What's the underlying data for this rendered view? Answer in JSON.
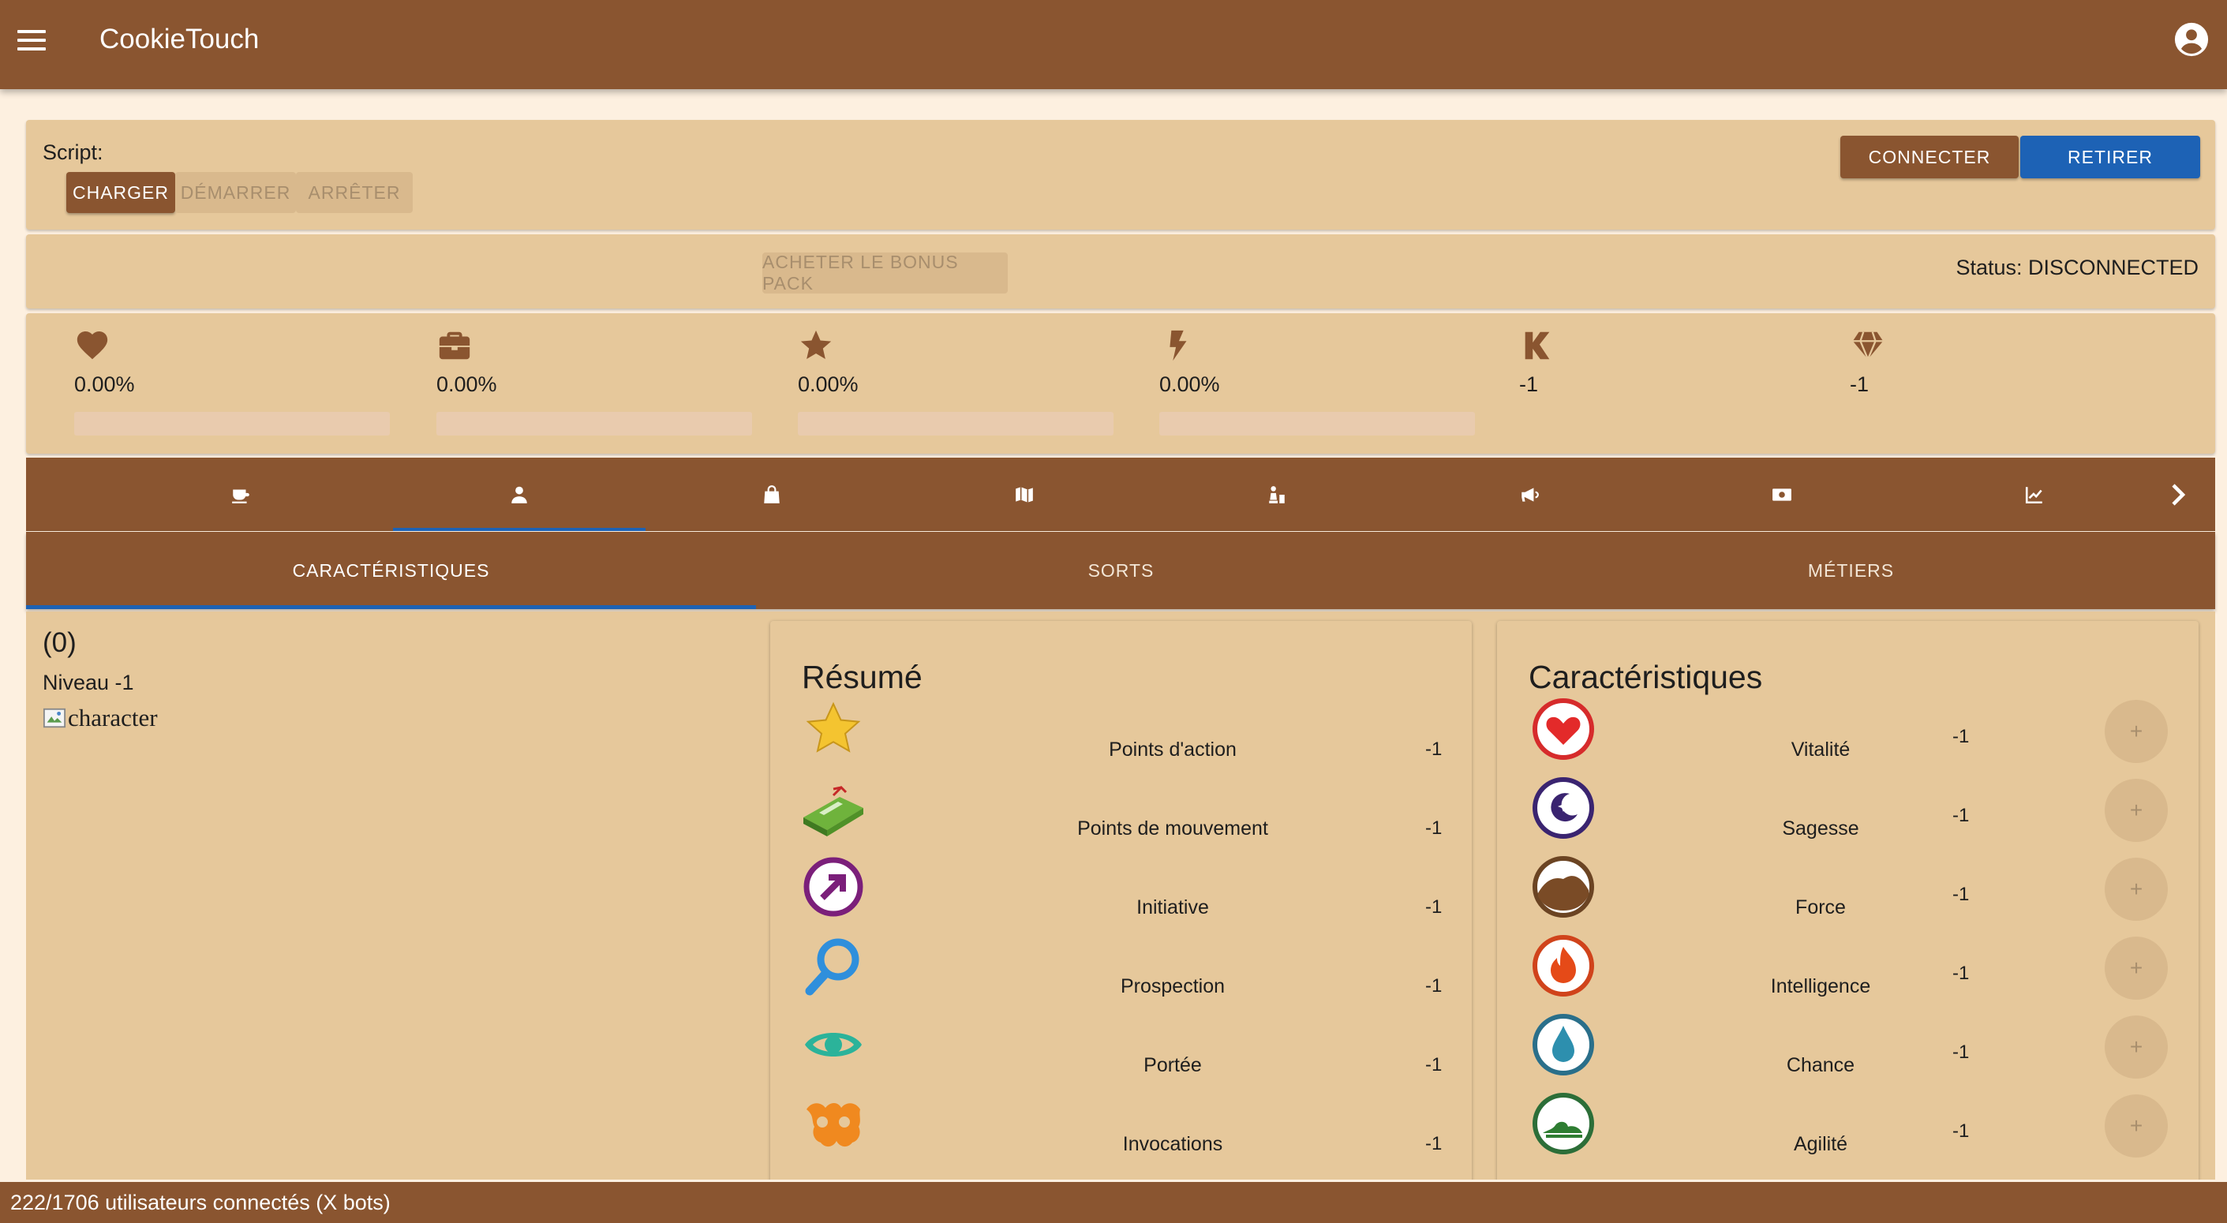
{
  "app": {
    "title": "CookieTouch"
  },
  "script": {
    "label": "Script:",
    "load": "CHARGER",
    "start": "DÉMARRER",
    "stop": "ARRÊTER",
    "connect": "CONNECTER",
    "remove": "RETIRER"
  },
  "bonus": {
    "buy": "ACHETER LE BONUS PACK",
    "status": "Status: DISCONNECTED"
  },
  "stats": [
    {
      "icon": "heart-icon",
      "value": "0.00%",
      "progress": 0
    },
    {
      "icon": "briefcase-icon",
      "value": "0.00%",
      "progress": 0
    },
    {
      "icon": "star-icon",
      "value": "0.00%",
      "progress": 0
    },
    {
      "icon": "bolt-icon",
      "value": "0.00%",
      "progress": 0
    },
    {
      "icon": "kamas-icon",
      "value": "-1"
    },
    {
      "icon": "gem-icon",
      "value": "-1"
    }
  ],
  "nav": {
    "tabs": [
      "coffee-icon",
      "person-icon",
      "bag-icon",
      "map-icon",
      "chess-icon",
      "megaphone-icon",
      "money-icon",
      "chart-icon"
    ],
    "active": "person-icon",
    "next": "chevron-right-icon"
  },
  "subtabs": {
    "items": [
      "CARACTÉRISTIQUES",
      "SORTS",
      "MÉTIERS"
    ],
    "active": "CARACTÉRISTIQUES"
  },
  "character": {
    "name": "(0)",
    "level": "Niveau -1",
    "image_alt": "character"
  },
  "resume": {
    "title": "Résumé",
    "rows": [
      {
        "icon": "star-icon",
        "label": "Points d'action",
        "value": "-1"
      },
      {
        "icon": "movement-icon",
        "label": "Points de mouvement",
        "value": "-1"
      },
      {
        "icon": "initiative-icon",
        "label": "Initiative",
        "value": "-1"
      },
      {
        "icon": "magnifier-icon",
        "label": "Prospection",
        "value": "-1"
      },
      {
        "icon": "eye-icon",
        "label": "Portée",
        "value": "-1"
      },
      {
        "icon": "invocation-icon",
        "label": "Invocations",
        "value": "-1"
      }
    ]
  },
  "caracs": {
    "title": "Caractéristiques",
    "plus": "+",
    "rows": [
      {
        "icon": "vitality-icon",
        "label": "Vitalité",
        "value": "-1"
      },
      {
        "icon": "wisdom-icon",
        "label": "Sagesse",
        "value": "-1"
      },
      {
        "icon": "strength-icon",
        "label": "Force",
        "value": "-1"
      },
      {
        "icon": "intelligence-icon",
        "label": "Intelligence",
        "value": "-1"
      },
      {
        "icon": "chance-icon",
        "label": "Chance",
        "value": "-1"
      },
      {
        "icon": "agility-icon",
        "label": "Agilité",
        "value": "-1"
      }
    ]
  },
  "footer": {
    "text": "222/1706 utilisateurs connectés (X bots)"
  },
  "colors": {
    "primary": "#8a5530",
    "accent": "#1d62b5",
    "card": "#e6c89b",
    "background": "#fdf0e0"
  }
}
